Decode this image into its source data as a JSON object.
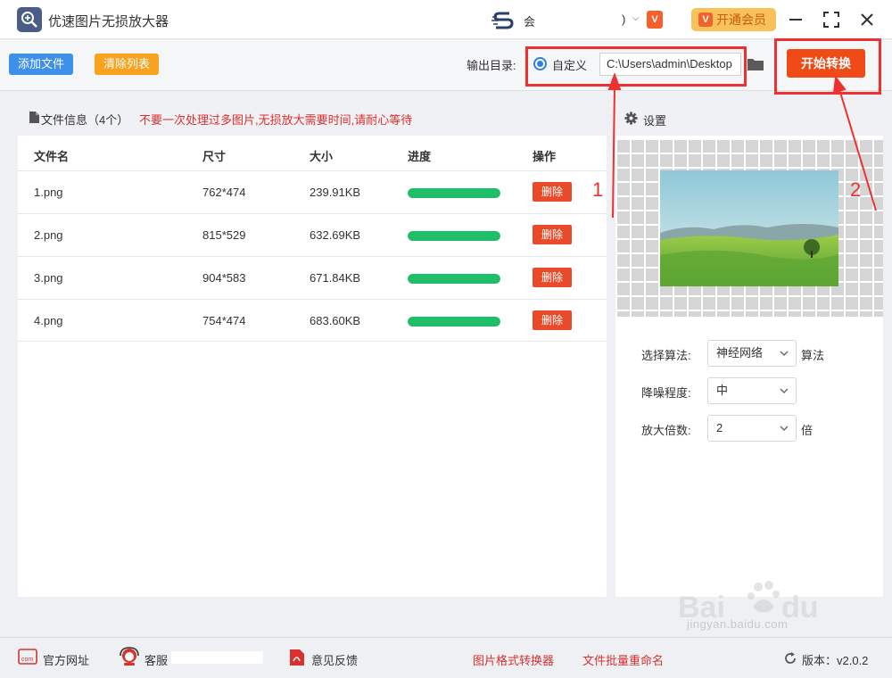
{
  "app": {
    "title": "优速图片无损放大器",
    "user_name": "会",
    "user_name_suffix": ")",
    "vip_badge": "V",
    "vip_button": "开通会员"
  },
  "toolbar": {
    "add_files": "添加文件",
    "clear_list": "清除列表",
    "output_dir_label": "输出目录:",
    "custom_label": "自定义",
    "output_path": "C:\\Users\\admin\\Desktop",
    "start_button": "开始转换"
  },
  "file_panel": {
    "title": "文件信息（4个）",
    "warning": "不要一次处理过多图片,无损放大需要时间,请耐心等待",
    "columns": [
      "文件名",
      "尺寸",
      "大小",
      "进度",
      "操作"
    ],
    "rows": [
      {
        "name": "1.png",
        "size": "762*474",
        "bytes": "239.91KB",
        "progress": 1.0,
        "action": "删除"
      },
      {
        "name": "2.png",
        "size": "815*529",
        "bytes": "632.69KB",
        "progress": 1.0,
        "action": "删除"
      },
      {
        "name": "3.png",
        "size": "904*583",
        "bytes": "671.84KB",
        "progress": 1.0,
        "action": "删除"
      },
      {
        "name": "4.png",
        "size": "754*474",
        "bytes": "683.60KB",
        "progress": 1.0,
        "action": "删除"
      }
    ]
  },
  "annotations": {
    "step1": "1",
    "step2": "2",
    "color": "#ee3030"
  },
  "settings": {
    "title": "设置",
    "algorithm_label": "选择算法:",
    "algorithm_value": "神经网络",
    "algorithm_suffix": "算法",
    "denoise_label": "降噪程度:",
    "denoise_value": "中",
    "scale_label": "放大倍数:",
    "scale_value": "2",
    "scale_suffix": "倍"
  },
  "footer": {
    "website": "官方网址",
    "service": "客服",
    "feedback": "意见反馈",
    "format_converter": "图片格式转换器",
    "batch_rename": "文件批量重命名",
    "version": "版本：v2.0.2"
  },
  "watermark": {
    "text": "jingyan.baidu.com"
  },
  "colors": {
    "primary_blue": "#3d90ea",
    "clear_orange": "#f8a21e",
    "start_red": "#f04a17",
    "progress_green": "#1fbf6a",
    "delete_red": "#e84a2a"
  }
}
